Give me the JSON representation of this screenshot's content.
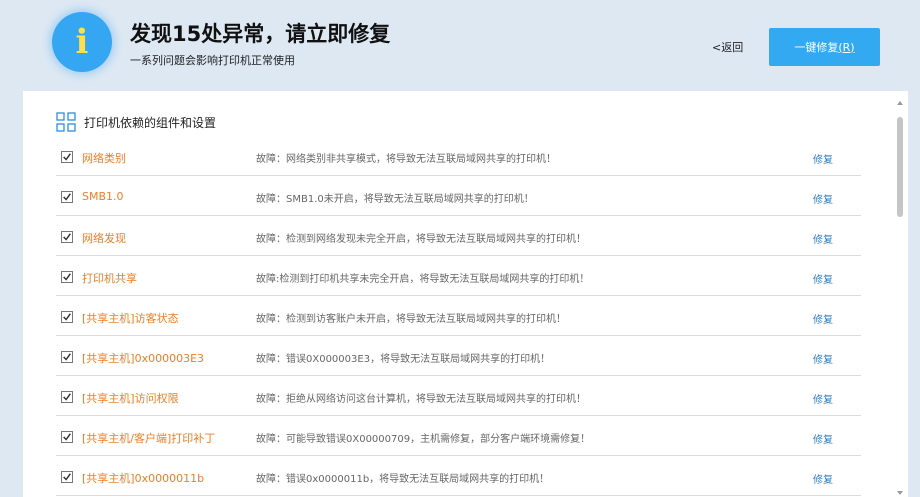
{
  "header": {
    "badge_glyph": "i",
    "title": "发现15处异常，请立即修复",
    "subtitle": "一系列问题会影响打印机正常使用",
    "back_label": "<返回",
    "fix_all_label": "一键修复",
    "fix_all_shortcut": "(R)"
  },
  "section": {
    "icon": "grid-icon",
    "title": "打印机依赖的组件和设置"
  },
  "rows": [
    {
      "name": "网络类别",
      "desc": "故障：网络类别非共享模式，将导致无法互联局域网共享的打印机！",
      "checked": true,
      "action": "修复"
    },
    {
      "name": "SMB1.0",
      "desc": "故障：SMB1.0未开启，将导致无法互联局域网共享的打印机！",
      "checked": true,
      "action": "修复"
    },
    {
      "name": "网络发现",
      "desc": "故障：检测到网络发现未完全开启，将导致无法互联局域网共享的打印机！",
      "checked": true,
      "action": "修复"
    },
    {
      "name": "打印机共享",
      "desc": "故障:检测到打印机共享未完全开启，将导致无法互联局域网共享的打印机！",
      "checked": true,
      "action": "修复"
    },
    {
      "name": "[共享主机]访客状态",
      "desc": "故障：检测到访客账户未开启，将导致无法互联局域网共享的打印机！",
      "checked": true,
      "action": "修复"
    },
    {
      "name": "[共享主机]0x000003E3",
      "desc": "故障：错误0X000003E3，将导致无法互联局域网共享的打印机！",
      "checked": true,
      "action": "修复"
    },
    {
      "name": "[共享主机]访问权限",
      "desc": "故障：拒绝从网络访问这台计算机，将导致无法互联局域网共享的打印机！",
      "checked": true,
      "action": "修复"
    },
    {
      "name": "[共享主机/客户端]打印补丁",
      "desc": "故障：可能导致错误0X00000709，主机需修复，部分客户端环境需修复！",
      "checked": true,
      "action": "修复"
    },
    {
      "name": "[共享主机]0x0000011b",
      "desc": "故障：错误0x0000011b，将导致无法互联局域网共享的打印机！",
      "checked": true,
      "action": "修复"
    }
  ],
  "colors": {
    "accent": "#33a9f1",
    "issue_name": "#ea7f25",
    "repair_link": "#2d7cc3",
    "badge_glyph": "#ffe04a"
  }
}
